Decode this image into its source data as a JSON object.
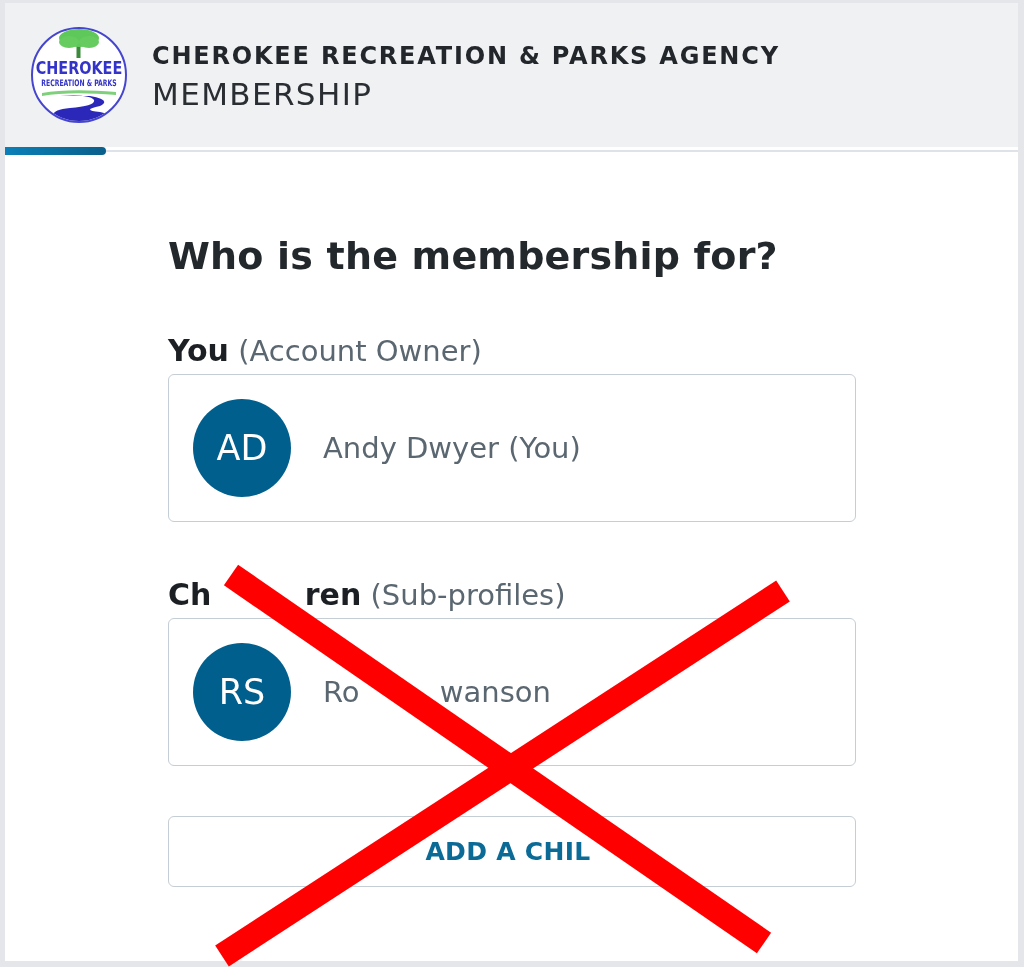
{
  "header": {
    "logo": {
      "name": "CHEROKEE",
      "tagline": "RECREATION & PARKS"
    },
    "agency": "CHEROKEE RECREATION & PARKS AGENCY",
    "section": "MEMBERSHIP"
  },
  "progress": {
    "level": 0.1
  },
  "question": "Who is the membership for?",
  "groups": [
    {
      "label": "**You** (Account Owner)",
      "profiles": [
        {
          "initials": "AD",
          "name": "Andy Dwyer (You)"
        }
      ]
    },
    {
      "label": "**Ch ren** (Sub-profiles)",
      "profiles": [
        {
          "initials": "RS",
          "name": "Ro wanson"
        }
      ]
    }
  ],
  "add_button": "ADD A CHIL"
}
